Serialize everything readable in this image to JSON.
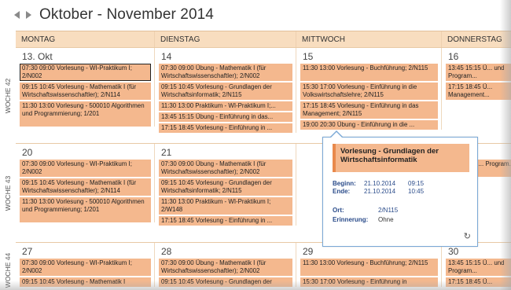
{
  "header": {
    "title": "Oktober - November 2014"
  },
  "days": [
    "MONTAG",
    "DIENSTAG",
    "MITTWOCH",
    "DONNERSTAG"
  ],
  "weeks": [
    {
      "label": "WOCHE 42",
      "cells": [
        {
          "date": "13. Okt",
          "events": [
            "07:30 09:00 Vorlesung - WI-Praktikum I; 2/N002",
            "09:15 10:45 Vorlesung - Mathematik I (für Wirtschaftswissenschaftler); 2/N114",
            "11:30 13:00 Vorlesung - 500010 Algorithmen und Programmierung; 1/201"
          ]
        },
        {
          "date": "14",
          "events": [
            "07:30 09:00 Übung - Mathematik I (für Wirtschaftswissenschaftler); 2/N002",
            "09:15 10:45 Vorlesung - Grundlagen der Wirtschaftsinformatik; 2/N115",
            "11:30 13:00 Praktikum - WI-Praktikum I;...",
            "13:45 15:15 Übung - Einführung in das...",
            "17:15 18:45 Vorlesung - Einführung in ..."
          ]
        },
        {
          "date": "15",
          "events": [
            "11:30 13:00 Vorlesung - Buchführung; 2/N115",
            "15:30 17:00 Vorlesung - Einführung in die Volkswirtschaftslehre; 2/N115",
            "17:15 18:45 Vorlesung - Einführung in das Management; 2/N115",
            "19:00 20:30 Übung - Einführung in die ..."
          ]
        },
        {
          "date": "16",
          "events": [
            "13:45 15:15 Ü... und Program...",
            "17:15 18:45 Ü... Management..."
          ]
        }
      ]
    },
    {
      "label": "WOCHE 43",
      "cells": [
        {
          "date": "20",
          "events": [
            "07:30 09:00 Vorlesung - WI-Praktikum I; 2/N002",
            "09:15 10:45 Vorlesung - Mathematik I (für Wirtschaftswissenschaftler); 2/N114",
            "11:30 13:00 Vorlesung - 500010 Algorithmen und Programmierung; 1/201"
          ]
        },
        {
          "date": "21",
          "events": [
            "07:30 09:00 Übung - Mathematik I (für Wirtschaftswissenschaftler); 2/N002",
            "09:15 10:45 Vorlesung - Grundlagen der Wirtschaftsinformatik; 2/N115",
            "11:30 13:00 Praktikum - WI-Praktikum I; 2/W148",
            "17:15 18:45 Vorlesung - Einführung in ..."
          ]
        },
        {
          "date": "",
          "events": []
        },
        {
          "date": "",
          "events": [
            "45 15:15 Ü... Program..."
          ]
        }
      ]
    },
    {
      "label": "WOCHE 44",
      "cells": [
        {
          "date": "27",
          "events": [
            "07:30 09:00 Vorlesung - WI-Praktikum I; 2/N002",
            "09:15 10:45 Vorlesung - Mathematik I"
          ]
        },
        {
          "date": "28",
          "events": [
            "07:30 09:00 Übung - Mathematik I (für Wirtschaftswissenschaftler); 2/N002",
            "09:15 10:45 Vorlesung - Grundlagen der"
          ]
        },
        {
          "date": "29",
          "events": [
            "11:30 13:00 Vorlesung - Buchführung; 2/N115",
            "15:30 17:00 Vorlesung - Einführung in"
          ]
        },
        {
          "date": "30",
          "events": [
            "13:45 15:15 Ü... und Program...",
            "17:15 18:45 Ü..."
          ]
        }
      ]
    }
  ],
  "popup": {
    "title": "Vorlesung - Grundlagen der Wirtschaftsinformatik",
    "begin_label": "Beginn:",
    "begin_date": "21.10.2014",
    "begin_time": "09:15",
    "end_label": "Ende:",
    "end_date": "21.10.2014",
    "end_time": "10:45",
    "location_label": "Ort:",
    "location": "2/N115",
    "reminder_label": "Erinnerung:",
    "reminder": "Ohne"
  },
  "colors": {
    "event": "#f4b88e",
    "header": "#f8ddbf",
    "accent": "#e8894c"
  }
}
